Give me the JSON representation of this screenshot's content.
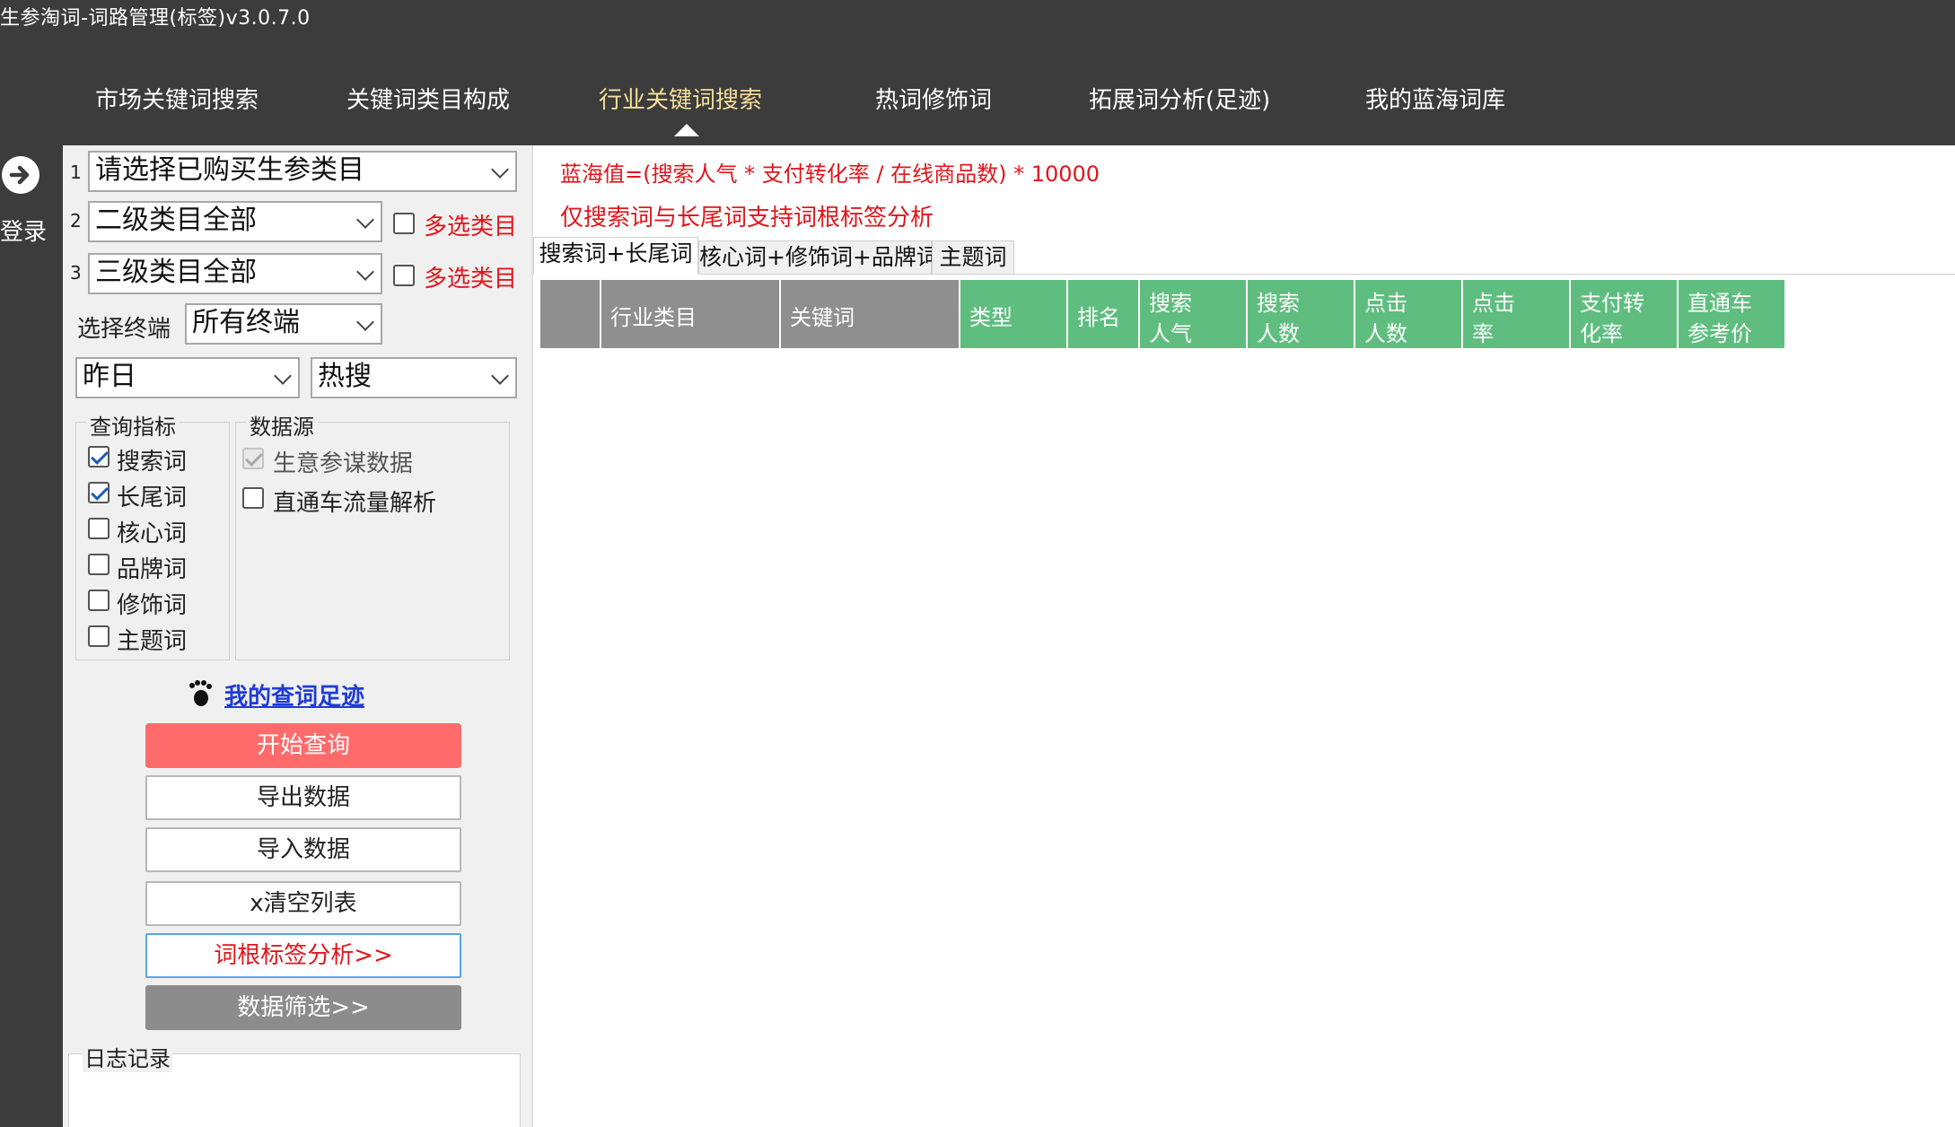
{
  "app": {
    "title": "生参淘词-词路管理(标签)v3.0.7.0"
  },
  "nav": {
    "tabs": [
      {
        "label": "市场关键词搜索"
      },
      {
        "label": "关键词类目构成"
      },
      {
        "label": "行业关键词搜索"
      },
      {
        "label": "热词修饰词"
      },
      {
        "label": "拓展词分析(足迹)"
      },
      {
        "label": "我的蓝海词库"
      }
    ],
    "active_index": 2
  },
  "sidebar": {
    "login_label": "登录",
    "login_icon": "arrow-right-circle-icon"
  },
  "filters": {
    "row1": {
      "num": "1",
      "value": "请选择已购买生参类目"
    },
    "row2": {
      "num": "2",
      "value": "二级类目全部",
      "multi_label": "多选类目",
      "multi_checked": false
    },
    "row3": {
      "num": "3",
      "value": "三级类目全部",
      "multi_label": "多选类目",
      "multi_checked": false
    },
    "terminal_label": "选择终端",
    "terminal_value": "所有终端",
    "date_value": "昨日",
    "sort_value": "热搜"
  },
  "query_metrics": {
    "title": "查询指标",
    "items": [
      {
        "label": "搜索词",
        "checked": true
      },
      {
        "label": "长尾词",
        "checked": true
      },
      {
        "label": "核心词",
        "checked": false
      },
      {
        "label": "品牌词",
        "checked": false
      },
      {
        "label": "修饰词",
        "checked": false
      },
      {
        "label": "主题词",
        "checked": false
      }
    ]
  },
  "data_source": {
    "title": "数据源",
    "items": [
      {
        "label": "生意参谋数据",
        "checked": true,
        "disabled": true
      },
      {
        "label": "直通车流量解析",
        "checked": false,
        "disabled": false
      }
    ]
  },
  "footprint_link": "我的查词足迹",
  "buttons": {
    "start": "开始查询",
    "export": "导出数据",
    "import": "导入数据",
    "clear": "x清空列表",
    "root_analysis": "词根标签分析>>",
    "filter": "数据筛选>>"
  },
  "log": {
    "title": "日志记录"
  },
  "main": {
    "formula": "蓝海值=(搜索人气 * 支付转化率 / 在线商品数) * 10000",
    "note": "仅搜索词与长尾词支持词根标签分析",
    "subtabs": [
      {
        "label": "搜索词+长尾词"
      },
      {
        "label": "核心词+修饰词+品牌词"
      },
      {
        "label": "主题词"
      }
    ],
    "active_subtab": 0,
    "table_headers": [
      {
        "l1": "",
        "l2": ""
      },
      {
        "l1": "行业类目",
        "l2": ""
      },
      {
        "l1": "关键词",
        "l2": ""
      },
      {
        "l1": "类型",
        "l2": ""
      },
      {
        "l1": "排名",
        "l2": ""
      },
      {
        "l1": "搜索",
        "l2": "人气"
      },
      {
        "l1": "搜索",
        "l2": "人数"
      },
      {
        "l1": "点击",
        "l2": "人数"
      },
      {
        "l1": "点击",
        "l2": "率"
      },
      {
        "l1": "支付转",
        "l2": "化率"
      },
      {
        "l1": "直通车",
        "l2": "参考价"
      }
    ]
  }
}
